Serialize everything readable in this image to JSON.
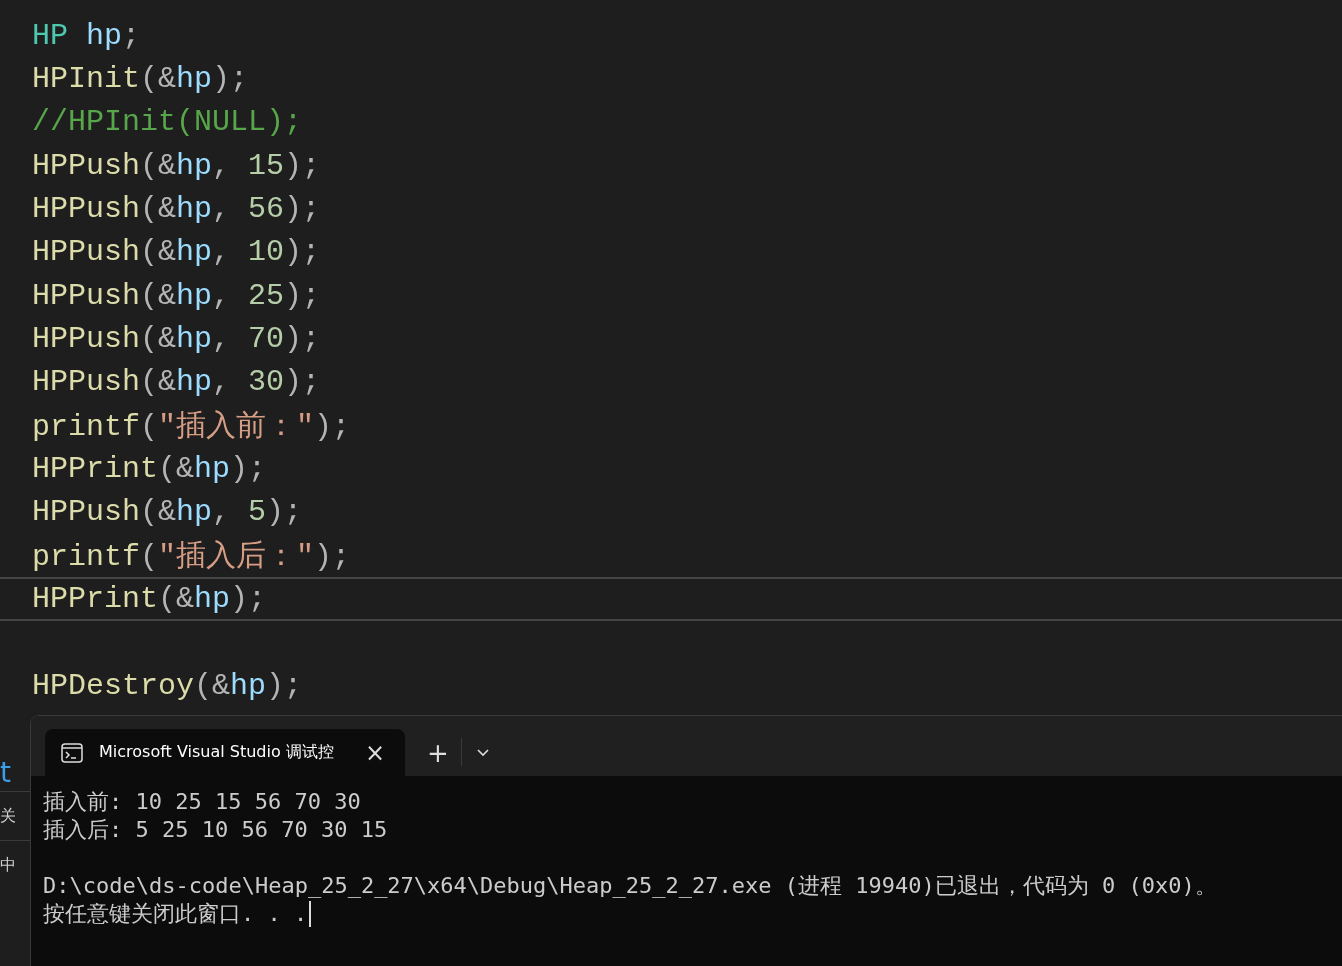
{
  "editor": {
    "lines": [
      {
        "current": false,
        "tokens": [
          {
            "kind": "type",
            "text": "HP "
          },
          {
            "kind": "var",
            "text": "hp"
          },
          {
            "kind": "punct",
            "text": ";"
          }
        ]
      },
      {
        "current": false,
        "tokens": [
          {
            "kind": "func",
            "text": "HPInit"
          },
          {
            "kind": "punct",
            "text": "(&"
          },
          {
            "kind": "var",
            "text": "hp"
          },
          {
            "kind": "punct",
            "text": ");"
          }
        ]
      },
      {
        "current": false,
        "tokens": [
          {
            "kind": "comment",
            "text": "//HPInit(NULL);"
          }
        ]
      },
      {
        "current": false,
        "tokens": [
          {
            "kind": "func",
            "text": "HPPush"
          },
          {
            "kind": "punct",
            "text": "(&"
          },
          {
            "kind": "var",
            "text": "hp"
          },
          {
            "kind": "punct",
            "text": ", "
          },
          {
            "kind": "number",
            "text": "15"
          },
          {
            "kind": "punct",
            "text": ");"
          }
        ]
      },
      {
        "current": false,
        "tokens": [
          {
            "kind": "func",
            "text": "HPPush"
          },
          {
            "kind": "punct",
            "text": "(&"
          },
          {
            "kind": "var",
            "text": "hp"
          },
          {
            "kind": "punct",
            "text": ", "
          },
          {
            "kind": "number",
            "text": "56"
          },
          {
            "kind": "punct",
            "text": ");"
          }
        ]
      },
      {
        "current": false,
        "tokens": [
          {
            "kind": "func",
            "text": "HPPush"
          },
          {
            "kind": "punct",
            "text": "(&"
          },
          {
            "kind": "var",
            "text": "hp"
          },
          {
            "kind": "punct",
            "text": ", "
          },
          {
            "kind": "number",
            "text": "10"
          },
          {
            "kind": "punct",
            "text": ");"
          }
        ]
      },
      {
        "current": false,
        "tokens": [
          {
            "kind": "func",
            "text": "HPPush"
          },
          {
            "kind": "punct",
            "text": "(&"
          },
          {
            "kind": "var",
            "text": "hp"
          },
          {
            "kind": "punct",
            "text": ", "
          },
          {
            "kind": "number",
            "text": "25"
          },
          {
            "kind": "punct",
            "text": ");"
          }
        ]
      },
      {
        "current": false,
        "tokens": [
          {
            "kind": "func",
            "text": "HPPush"
          },
          {
            "kind": "punct",
            "text": "(&"
          },
          {
            "kind": "var",
            "text": "hp"
          },
          {
            "kind": "punct",
            "text": ", "
          },
          {
            "kind": "number",
            "text": "70"
          },
          {
            "kind": "punct",
            "text": ");"
          }
        ]
      },
      {
        "current": false,
        "tokens": [
          {
            "kind": "func",
            "text": "HPPush"
          },
          {
            "kind": "punct",
            "text": "(&"
          },
          {
            "kind": "var",
            "text": "hp"
          },
          {
            "kind": "punct",
            "text": ", "
          },
          {
            "kind": "number",
            "text": "30"
          },
          {
            "kind": "punct",
            "text": ");"
          }
        ]
      },
      {
        "current": false,
        "tokens": [
          {
            "kind": "func",
            "text": "printf"
          },
          {
            "kind": "punct",
            "text": "("
          },
          {
            "kind": "string",
            "text": "\"插入前：\""
          },
          {
            "kind": "punct",
            "text": ");"
          }
        ]
      },
      {
        "current": false,
        "tokens": [
          {
            "kind": "func",
            "text": "HPPrint"
          },
          {
            "kind": "punct",
            "text": "(&"
          },
          {
            "kind": "var",
            "text": "hp"
          },
          {
            "kind": "punct",
            "text": ");"
          }
        ]
      },
      {
        "current": false,
        "tokens": [
          {
            "kind": "func",
            "text": "HPPush"
          },
          {
            "kind": "punct",
            "text": "(&"
          },
          {
            "kind": "var",
            "text": "hp"
          },
          {
            "kind": "punct",
            "text": ", "
          },
          {
            "kind": "number",
            "text": "5"
          },
          {
            "kind": "punct",
            "text": ");"
          }
        ]
      },
      {
        "current": false,
        "tokens": [
          {
            "kind": "func",
            "text": "printf"
          },
          {
            "kind": "punct",
            "text": "("
          },
          {
            "kind": "string",
            "text": "\"插入后：\""
          },
          {
            "kind": "punct",
            "text": ");"
          }
        ]
      },
      {
        "current": true,
        "tokens": [
          {
            "kind": "func",
            "text": "HPPrint"
          },
          {
            "kind": "punct",
            "text": "(&"
          },
          {
            "kind": "var",
            "text": "hp"
          },
          {
            "kind": "punct",
            "text": ");"
          }
        ]
      },
      {
        "current": false
      },
      {
        "current": false,
        "tokens": [
          {
            "kind": "func",
            "text": "HPDestroy"
          },
          {
            "kind": "punct",
            "text": "(&"
          },
          {
            "kind": "var",
            "text": "hp"
          },
          {
            "kind": "punct",
            "text": ");"
          }
        ]
      }
    ]
  },
  "background_fragments": [
    {
      "kind": "link",
      "text": "t"
    },
    {
      "kind": "text",
      "text": "关"
    },
    {
      "kind": "text",
      "text": "中"
    }
  ],
  "console": {
    "tab": {
      "title": "Microsoft Visual Studio 调试控",
      "close": "×",
      "selected": true
    },
    "new_tab": "+",
    "blocks": [
      [
        "插入前: 10 25 15 56 70 30",
        "插入后: 5 25 10 56 70 30 15"
      ],
      [
        "D:\\code\\ds-code\\Heap_25_2_27\\x64\\Debug\\Heap_25_2_27.exe (进程 19940)已退出，代码为 0 (0x0)。",
        "按任意键关闭此窗口. . ."
      ]
    ]
  }
}
